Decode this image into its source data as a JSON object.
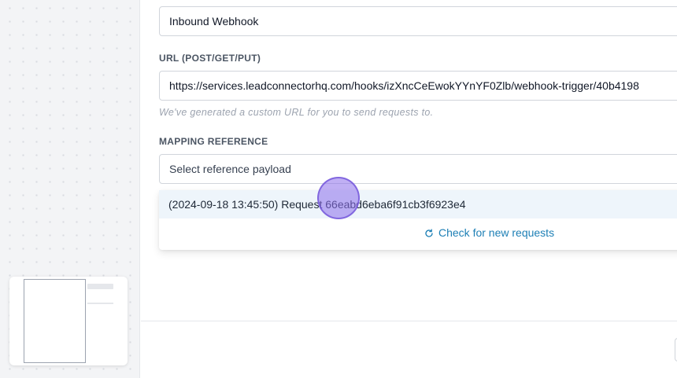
{
  "workflow": {
    "trigger_name": "Inbound Webhook",
    "url_label": "URL (POST/GET/PUT)",
    "url_value": "https://services.leadconnectorhq.com/hooks/izXncCeEwokYYnYF0Zlb/webhook-trigger/40b4198",
    "url_helper": "We've generated a custom URL for you to send requests to.",
    "mapping_label": "MAPPING REFERENCE",
    "mapping_placeholder": "Select reference payload",
    "dropdown": {
      "options": [
        {
          "label": "(2024-09-18 13:45:50) Request 66eabd6eba6f91cb3f6923e4"
        }
      ],
      "check_label": "Check for new requests"
    }
  },
  "icons": {
    "refresh": "refresh-icon"
  },
  "colors": {
    "link": "#1d7fb5",
    "highlight": "#eef5fb",
    "cursor": "#8c6eeb"
  }
}
